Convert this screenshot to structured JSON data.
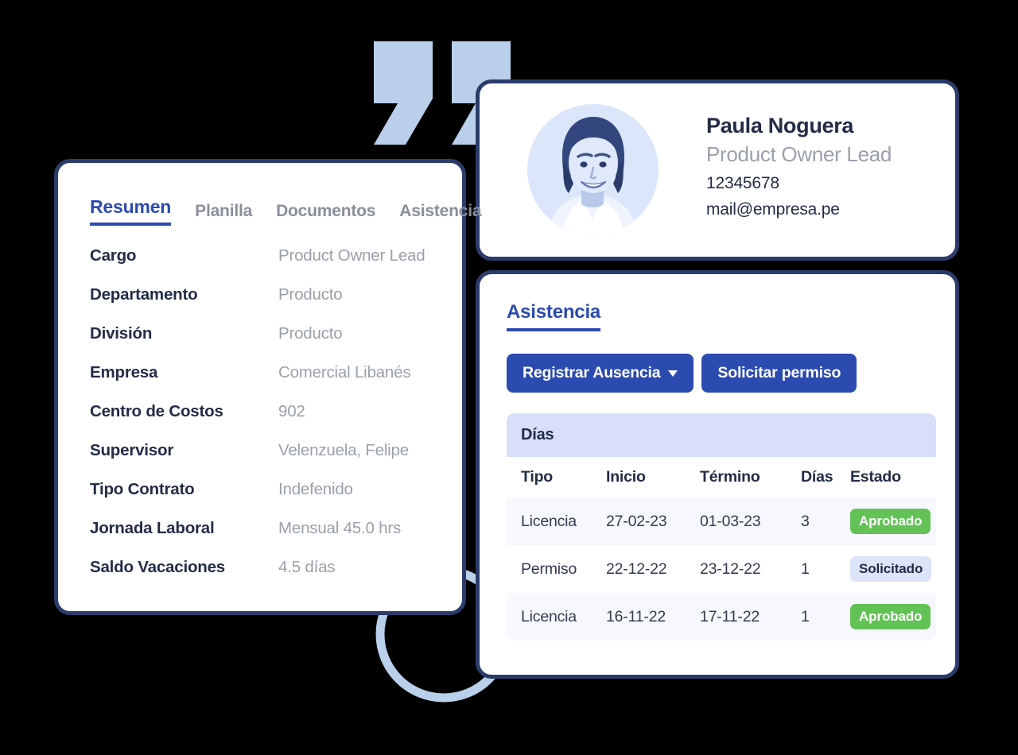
{
  "background_color": "#000000",
  "theme": {
    "card_border": "#2b3c6b",
    "primary_blue": "#2b4bb0",
    "muted_text": "#9aa0ab",
    "dark_text": "#232c47",
    "decor_light_blue": "#b9cfea",
    "band_blue": "#d7e0f8",
    "badge_green": "#63c256",
    "badge_lavender": "#dde4f8",
    "avatar_bg": "#dbe6fa"
  },
  "decor": {
    "quote_mark_name": "quotation-mark-decoration",
    "ring_name": "circle-outline-decoration"
  },
  "summary_card": {
    "tabs": [
      {
        "label": "Resumen",
        "active": true
      },
      {
        "label": "Planilla",
        "active": false
      },
      {
        "label": "Documentos",
        "active": false
      },
      {
        "label": "Asistencia",
        "active": false
      }
    ],
    "rows": [
      {
        "label": "Cargo",
        "value": "Product Owner Lead"
      },
      {
        "label": "Departamento",
        "value": "Producto"
      },
      {
        "label": "División",
        "value": "Producto"
      },
      {
        "label": "Empresa",
        "value": "Comercial Libanés"
      },
      {
        "label": "Centro de Costos",
        "value": "902"
      },
      {
        "label": "Supervisor",
        "value": "Velenzuela, Felipe"
      },
      {
        "label": "Tipo Contrato",
        "value": "Indefenido"
      },
      {
        "label": "Jornada Laboral",
        "value": "Mensual 45.0 hrs"
      },
      {
        "label": "Saldo Vacaciones",
        "value": "4.5 días"
      }
    ]
  },
  "profile_card": {
    "avatar_alt": "employee-photo",
    "name": "Paula Noguera",
    "role": "Product Owner Lead",
    "document_id": "12345678",
    "email": "mail@empresa.pe"
  },
  "attendance_card": {
    "title": "Asistencia",
    "buttons": [
      {
        "label": "Registrar Ausencia",
        "has_caret": true
      },
      {
        "label": "Solicitar permiso",
        "has_caret": false
      }
    ],
    "table": {
      "band_title": "Días",
      "columns": [
        "Tipo",
        "Inicio",
        "Término",
        "Días",
        "Estado"
      ],
      "rows": [
        {
          "tipo": "Licencia",
          "inicio": "27-02-23",
          "termino": "01-03-23",
          "dias": "3",
          "estado": "Aprobado",
          "estado_kind": "approved"
        },
        {
          "tipo": "Permiso",
          "inicio": "22-12-22",
          "termino": "23-12-22",
          "dias": "1",
          "estado": "Solicitado",
          "estado_kind": "requested"
        },
        {
          "tipo": "Licencia",
          "inicio": "16-11-22",
          "termino": "17-11-22",
          "dias": "1",
          "estado": "Aprobado",
          "estado_kind": "approved"
        }
      ]
    }
  }
}
